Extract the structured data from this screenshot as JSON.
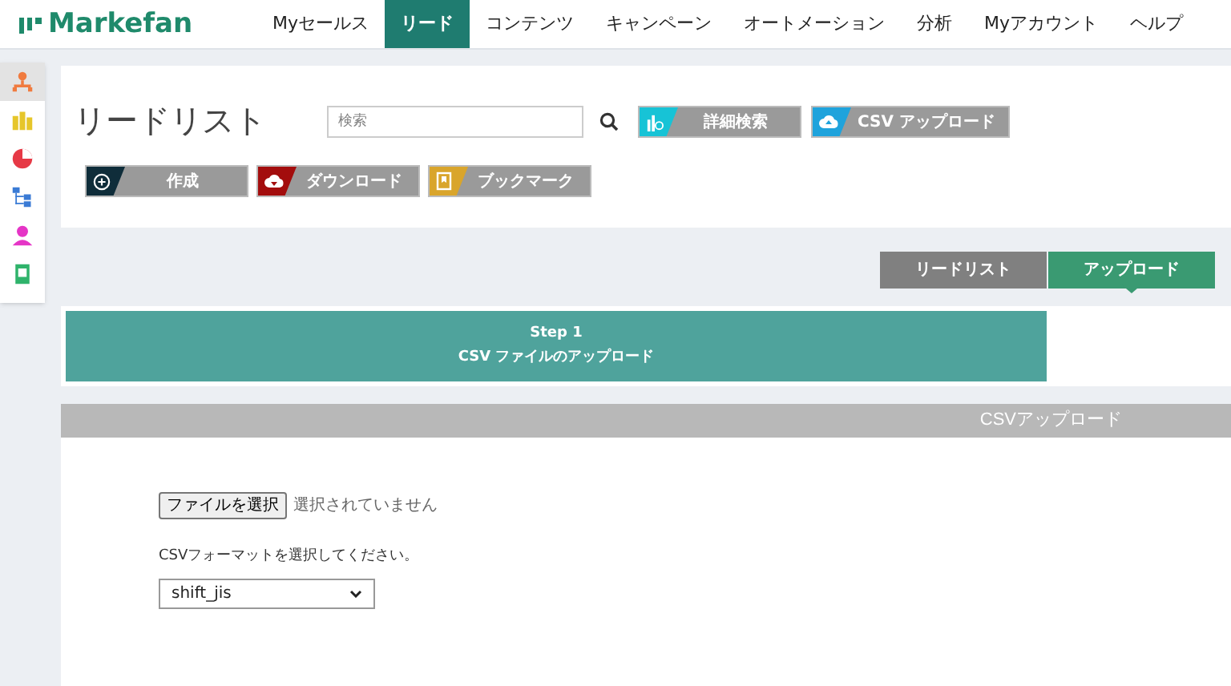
{
  "logo": {
    "text": "Markefan"
  },
  "nav": [
    {
      "label": "Myセールス",
      "selected": false
    },
    {
      "label": "リード",
      "selected": true
    },
    {
      "label": "コンテンツ",
      "selected": false
    },
    {
      "label": "キャンペーン",
      "selected": false
    },
    {
      "label": "オートメーション",
      "selected": false
    },
    {
      "label": "分析",
      "selected": false
    },
    {
      "label": "Myアカウント",
      "selected": false
    },
    {
      "label": "ヘルプ",
      "selected": false
    }
  ],
  "sidebar": {
    "items": [
      {
        "kind": "org",
        "selected": true
      },
      {
        "kind": "building",
        "selected": false
      },
      {
        "kind": "pie",
        "selected": false
      },
      {
        "kind": "tree",
        "selected": false
      },
      {
        "kind": "person",
        "selected": false
      },
      {
        "kind": "document",
        "selected": false
      }
    ]
  },
  "page_title": "リードリスト",
  "search": {
    "placeholder": "検索"
  },
  "header_buttons": [
    {
      "label": "詳細検索",
      "kind": "chart",
      "color": "#17c3d6"
    },
    {
      "label": "CSV アップロード",
      "kind": "cloud-up",
      "color": "#1fa3dc"
    }
  ],
  "action_buttons": [
    {
      "label": "作成",
      "kind": "plus",
      "color": "#0f2d3a"
    },
    {
      "label": "ダウンロード",
      "kind": "cloud-down",
      "color": "#a30d0d"
    },
    {
      "label": "ブックマーク",
      "kind": "bookmark",
      "color": "#d9a52c"
    }
  ],
  "view_tabs": [
    {
      "label": "リードリスト",
      "selected": false
    },
    {
      "label": "アップロード",
      "selected": true
    }
  ],
  "step": {
    "title": "Step 1",
    "subtitle": "CSV ファイルのアップロード"
  },
  "section_header": "CSVアップロード",
  "file_input": {
    "button": "ファイルを選択",
    "status": "選択されていません"
  },
  "format_label": "CSVフォーマットを選択してください。",
  "format_select": {
    "value": "shift_jis"
  }
}
